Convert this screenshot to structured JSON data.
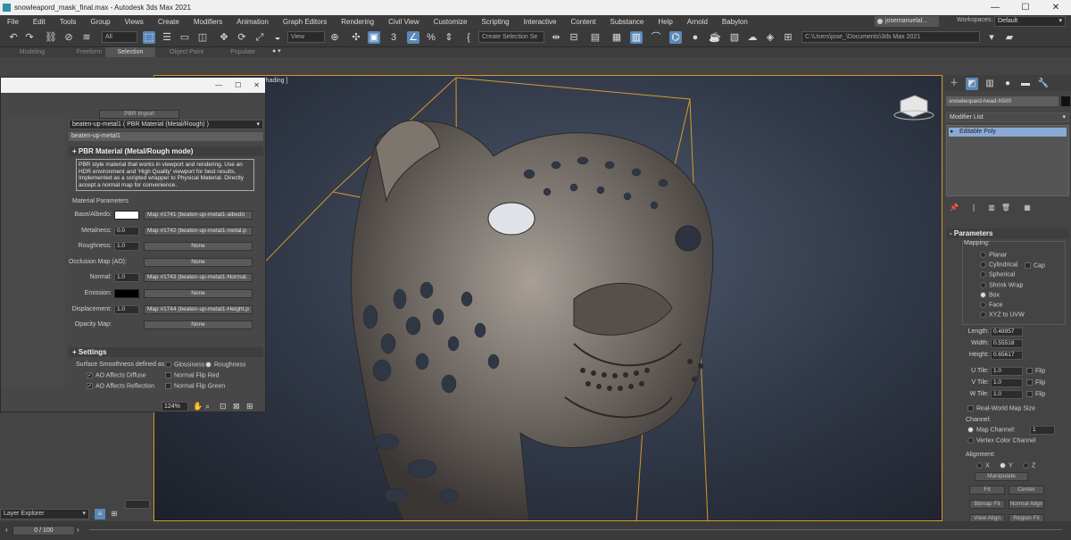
{
  "window": {
    "title": "snowleapord_mask_final.max - Autodesk 3ds Max 2021",
    "minimize": "—",
    "maximize": "☐",
    "close": "✕"
  },
  "menu": [
    "File",
    "Edit",
    "Tools",
    "Group",
    "Views",
    "Create",
    "Modifiers",
    "Animation",
    "Graph Editors",
    "Rendering",
    "Civil View",
    "Customize",
    "Scripting",
    "Interactive",
    "Content",
    "Substance",
    "Help",
    "Arnold",
    "Babylon"
  ],
  "user": {
    "name": "josemanuelal...",
    "workspaces_label": "Workspaces:",
    "workspace": "Default"
  },
  "toolbar": {
    "filter": "All",
    "ref_coord": "View",
    "selection_set": "Create Selection Se",
    "project_path": "C:\\Users\\jose_\\Documents\\3ds Max 2021"
  },
  "ribbon_tabs": [
    "Modeling",
    "Freeform",
    "Selection",
    "Object Paint",
    "Populate"
  ],
  "ribbon_active": "Selection",
  "viewport": {
    "label": "t Shading ]"
  },
  "material_dialog": {
    "minimize": "—",
    "maximize": "☐",
    "close": "✕",
    "import_btn": "PBR Import",
    "material_name": "beaten-up-metal1  ( PBR Material (Metal/Rough) )",
    "name_field": "beaten-up-metal1",
    "rollout_main": "PBR Material (Metal/Rough mode)",
    "description": "PBR style material that works in viewport and rendering. Use an HDR environment and 'High Quality' viewport for best results. Implemented as a scripted wrapper to Physical Material. Directly accept a normal map for convenience.",
    "params_header": "Material Parameters",
    "params": [
      {
        "label": "Base/Albedo:",
        "kind": "swatch",
        "color": "#ffffff",
        "map": "Map #1741 (beaten-up-metal1-albedo"
      },
      {
        "label": "Metalness:",
        "kind": "spin",
        "value": "0.0",
        "map": "Map #1742 (beaten-up-metal1-metal.p"
      },
      {
        "label": "Roughness:",
        "kind": "spin",
        "value": "1.0",
        "map": "None"
      },
      {
        "label": "Occlusion Map (AO):",
        "kind": "none",
        "map": "None"
      },
      {
        "label": "Normal:",
        "kind": "spin",
        "value": "1.0",
        "map": "Map #1743 (beaten-up-metal1-Normal."
      },
      {
        "label": "Emission:",
        "kind": "swatch",
        "color": "#000000",
        "map": "None"
      },
      {
        "label": "Displacement:",
        "kind": "spin",
        "value": "1.0",
        "map": "Map #1744 (beaten-up-metal1-Height.p"
      },
      {
        "label": "Opacity Map:",
        "kind": "none",
        "map": "None"
      }
    ],
    "settings_header": "Settings",
    "smoothness_label": "Surface Smoothness defined as",
    "smoothness_options": [
      "Glossiness",
      "Roughness"
    ],
    "smoothness_selected": "Roughness",
    "checks": [
      {
        "label": "AO Affects Diffuse",
        "checked": true
      },
      {
        "label": "Normal Flip Red",
        "checked": false
      },
      {
        "label": "AO Affects Reflection",
        "checked": true
      },
      {
        "label": "Normal Flip Green",
        "checked": false
      }
    ],
    "zoom": "124%"
  },
  "left_panel": {
    "layer_explorer": "Layer Explorer"
  },
  "command_panel": {
    "object_name": "snowleopard-head-h500",
    "modifier_list": "Modifier List",
    "stack": [
      {
        "label": "Editable Poly",
        "selected": true
      }
    ],
    "parameters_title": "Parameters",
    "mapping_label": "Mapping:",
    "mapping_options": [
      "Planar",
      "Cylindrical",
      "Spherical",
      "Shrink Wrap",
      "Box",
      "Face",
      "XYZ to UVW"
    ],
    "mapping_selected": "Box",
    "cap_label": "Cap",
    "dims": [
      {
        "label": "Length:",
        "value": "0.48957"
      },
      {
        "label": "Width:",
        "value": "0.55518"
      },
      {
        "label": "Height:",
        "value": "0.65617"
      }
    ],
    "tiles": [
      {
        "label": "U Tile:",
        "value": "1.0",
        "flip": "Flip"
      },
      {
        "label": "V Tile:",
        "value": "1.0",
        "flip": "Flip"
      },
      {
        "label": "W Tile:",
        "value": "1.0",
        "flip": "Flip"
      }
    ],
    "real_world": "Real-World Map Size",
    "channel_label": "Channel:",
    "map_channel_label": "Map Channel:",
    "map_channel_value": "1",
    "vertex_color_channel": "Vertex Color Channel",
    "alignment_label": "Alignment:",
    "axes": [
      "X",
      "Y",
      "Z"
    ],
    "axis_selected": "Y",
    "manipulate": "Manipulate",
    "buttons": [
      "Fit",
      "Center",
      "Bitmap Fit",
      "Normal Align",
      "View Align",
      "Region Fit"
    ]
  },
  "timeline": {
    "frame": "0 / 100"
  }
}
